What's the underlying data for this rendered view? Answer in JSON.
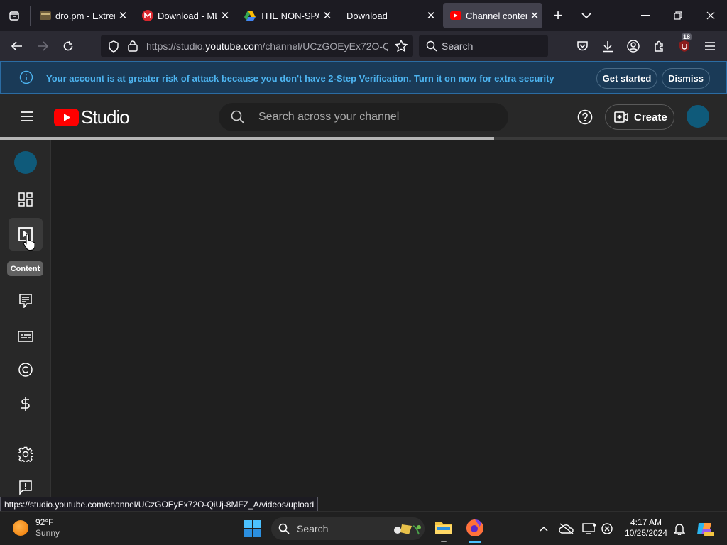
{
  "browser": {
    "tabs": [
      {
        "label": "dro.pm - Extrem",
        "icon": "dro-favicon",
        "active": false
      },
      {
        "label": "Download - MEGA",
        "icon": "mega-favicon",
        "active": false
      },
      {
        "label": "THE NON-SPAM",
        "icon": "google-drive-favicon",
        "active": false
      },
      {
        "label": "Download",
        "icon": "none",
        "active": false
      },
      {
        "label": "Channel content",
        "icon": "youtube-favicon",
        "active": true
      }
    ],
    "url_prefix": "https://studio.",
    "url_domain": "youtube.com",
    "url_path": "/channel/UCzGOEyEx72O-QiUj-8MFZ_A/videos/upload",
    "search_label": "Search",
    "extension_badge": "18",
    "status_link": "https://studio.youtube.com/channel/UCzGOEyEx72O-QiUj-8MFZ_A/videos/upload"
  },
  "banner": {
    "message": "Your account is at greater risk of attack because you don't have 2-Step Verification. Turn it on now for extra security",
    "get_started": "Get started",
    "dismiss": "Dismiss"
  },
  "studio": {
    "logo_text": "Studio",
    "search_placeholder": "Search across your channel",
    "create_label": "Create",
    "loading_progress": 0.68,
    "sidebar": {
      "items": [
        {
          "name": "dashboard",
          "icon": "dashboard-icon"
        },
        {
          "name": "content",
          "icon": "content-icon",
          "active": true
        },
        {
          "name": "comments",
          "icon": "comments-icon"
        },
        {
          "name": "subtitles",
          "icon": "subtitles-icon"
        },
        {
          "name": "copyright",
          "icon": "copyright-icon"
        },
        {
          "name": "earn",
          "icon": "earn-icon"
        },
        {
          "name": "settings",
          "icon": "gear-icon"
        },
        {
          "name": "feedback",
          "icon": "feedback-icon"
        }
      ],
      "tooltip": "Content"
    }
  },
  "taskbar": {
    "weather_temp": "92°F",
    "weather_desc": "Sunny",
    "search_label": "Search",
    "time": "4:17 AM",
    "date": "10/25/2024"
  },
  "colors": {
    "banner_bg": "#1a3a57",
    "banner_text": "#4db4f0",
    "youtube_red": "#ff0000",
    "avatar": "#0f5a7a"
  }
}
